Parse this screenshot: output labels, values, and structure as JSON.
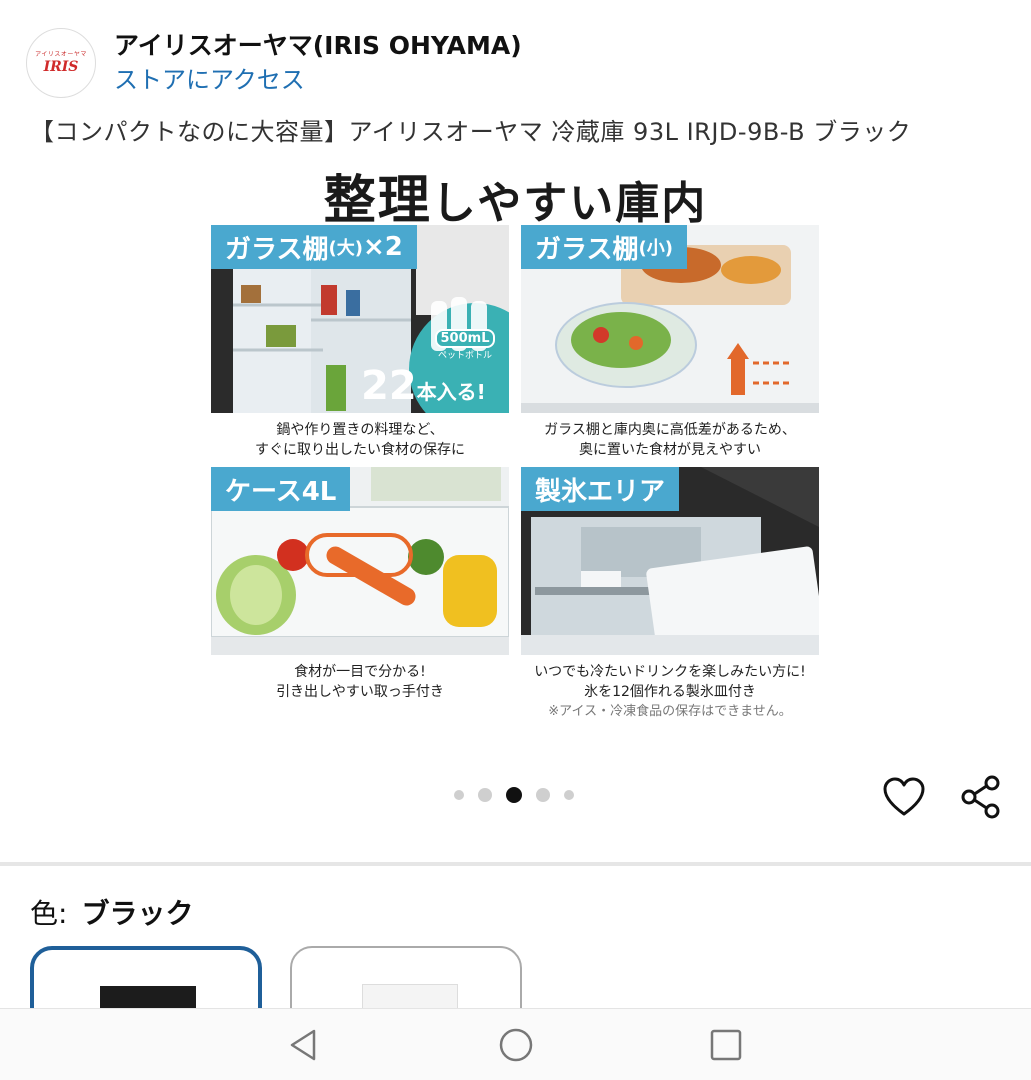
{
  "store": {
    "logo_tiny": "アイリスオーヤマ",
    "logo_mark": "IRIS",
    "name": "アイリスオーヤマ(IRIS OHYAMA)",
    "link": "ストアにアクセス"
  },
  "product": {
    "title": "【コンパクトなのに大容量】アイリスオーヤマ 冷蔵庫 93L IRJD-9B-B ブラック"
  },
  "hero": {
    "heading_big": "整理",
    "heading_rest": "しやすい庫内",
    "panels": [
      {
        "tag_main": "ガラス棚",
        "tag_small": "(大)",
        "tag_suffix": "×2",
        "badge_top": "500mL",
        "badge_sub": "ペットボトル",
        "badge_count": "22",
        "badge_unit": "本入る!",
        "caption_1": "鍋や作り置きの料理など、",
        "caption_2": "すぐに取り出したい食材の保存に"
      },
      {
        "tag_main": "ガラス棚",
        "tag_small": "(小)",
        "caption_1": "ガラス棚と庫内奥に高低差があるため、",
        "caption_2": "奥に置いた食材が見えやすい"
      },
      {
        "tag_main": "ケース4L",
        "caption_1": "食材が一目で分かる!",
        "caption_2": "引き出しやすい取っ手付き"
      },
      {
        "tag_main": "製氷エリア",
        "caption_1": "いつでも冷たいドリンクを楽しみたい方に!",
        "caption_2": "氷を12個作れる製氷皿付き",
        "caption_note": "※アイス・冷凍食品の保存はできません。"
      }
    ]
  },
  "carousel": {
    "total": 5,
    "active_index": 2
  },
  "variant": {
    "label": "色:",
    "value": "ブラック"
  },
  "colors": {
    "accent_blue": "#4aa8cf",
    "link_blue": "#1f6fb2",
    "selected_border": "#1f5f99"
  }
}
